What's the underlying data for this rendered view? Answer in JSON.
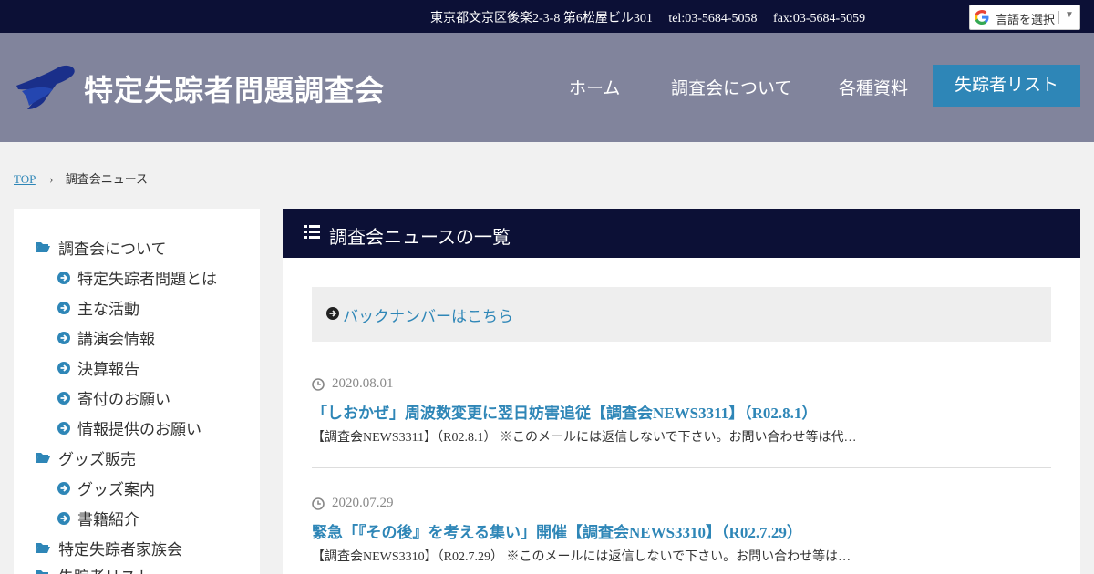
{
  "topbar": {
    "address": "東京都文京区後楽2-3-8 第6松屋ビル301",
    "tel": "tel:03-5684-5058",
    "fax": "fax:03-5684-5059",
    "translate_label": "言語を選択"
  },
  "header": {
    "site_title": "特定失踪者問題調査会",
    "nav": [
      "ホーム",
      "調査会について",
      "各種資料"
    ],
    "cta": "失踪者リスト"
  },
  "breadcrumb": {
    "home": "TOP",
    "current": "調査会ニュース"
  },
  "sidebar": {
    "items": [
      {
        "label": "調査会について",
        "level": 1,
        "icon": "folder-open-icon"
      },
      {
        "label": "特定失踪者問題とは",
        "level": 2,
        "icon": "arrow-circle-right-icon"
      },
      {
        "label": "主な活動",
        "level": 2,
        "icon": "arrow-circle-right-icon"
      },
      {
        "label": "講演会情報",
        "level": 2,
        "icon": "arrow-circle-right-icon"
      },
      {
        "label": "決算報告",
        "level": 2,
        "icon": "arrow-circle-right-icon"
      },
      {
        "label": "寄付のお願い",
        "level": 2,
        "icon": "arrow-circle-right-icon"
      },
      {
        "label": "情報提供のお願い",
        "level": 2,
        "icon": "arrow-circle-right-icon"
      },
      {
        "label": "グッズ販売",
        "level": 1,
        "icon": "folder-open-icon"
      },
      {
        "label": "グッズ案内",
        "level": 2,
        "icon": "arrow-circle-right-icon"
      },
      {
        "label": "書籍紹介",
        "level": 2,
        "icon": "arrow-circle-right-icon"
      },
      {
        "label": "特定失踪者家族会",
        "level": 1,
        "icon": "folder-open-icon"
      },
      {
        "label": "失踪者リスト",
        "level": 1,
        "icon": "folder-open-icon"
      }
    ]
  },
  "main": {
    "heading": "調査会ニュースの一覧",
    "backnumber_link": "バックナンバーはこちら",
    "posts": [
      {
        "date": "2020.08.01",
        "title": "「しおかぜ」周波数変更に翌日妨害追従【調査会NEWS3311】（R02.8.1）",
        "excerpt": "【調査会NEWS3311】（R02.8.1） ※このメールには返信しないで下さい。お問い合わせ等は代…"
      },
      {
        "date": "2020.07.29",
        "title": "緊急「『その後』を考える集い」開催【調査会NEWS3310】（R02.7.29）",
        "excerpt": "【調査会NEWS3310】（R02.7.29） ※このメールには返信しないで下さい。お問い合わせ等は…"
      }
    ]
  },
  "colors": {
    "navy": "#0c1036",
    "header_bg": "#81849c",
    "accent_blue": "#2e86b7"
  }
}
